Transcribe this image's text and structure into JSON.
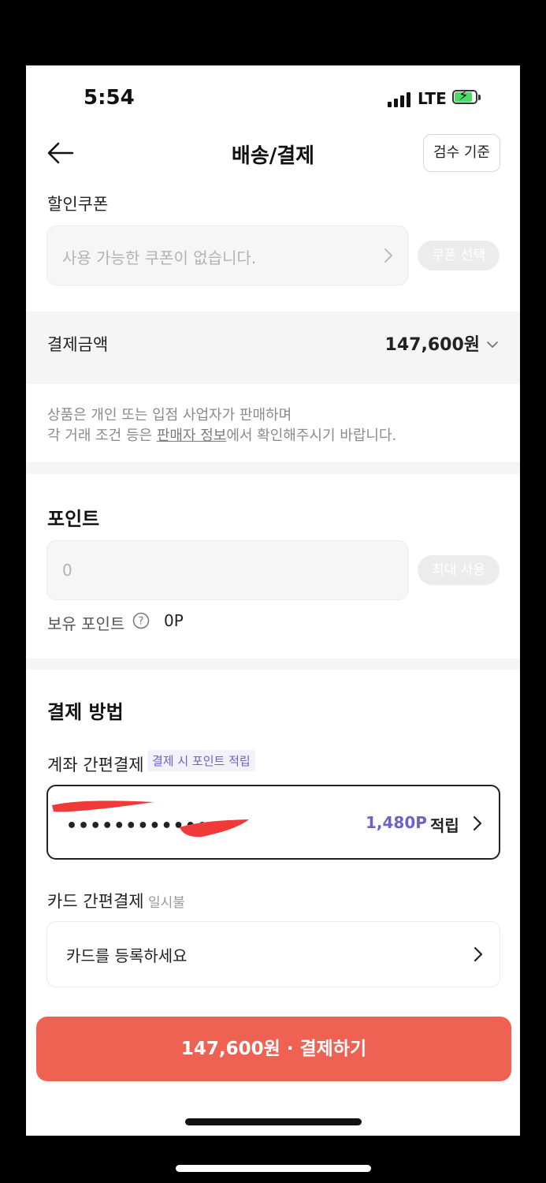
{
  "status_bar": {
    "time": "5:54",
    "network": "LTE"
  },
  "header": {
    "title": "배송/결제",
    "inspect_button": "검수 기준"
  },
  "coupon": {
    "label": "할인쿠폰",
    "placeholder": "사용 가능한 쿠폰이 없습니다.",
    "select_button": "쿠폰 선택"
  },
  "payment_amount": {
    "label": "결제금액",
    "value": "147,600원"
  },
  "notice": {
    "line1": "상품은 개인 또는 입점 사업자가 판매하며",
    "line2_prefix": "각 거래 조건 등은 ",
    "line2_link": "판매자 정보",
    "line2_suffix": "에서 확인해주시기 바랍니다."
  },
  "points": {
    "title": "포인트",
    "input_value": "0",
    "max_button": "최대 사용",
    "owned_label": "보유 포인트",
    "owned_value": "0P"
  },
  "payment_method": {
    "title": "결제 방법",
    "account": {
      "label": "계좌 간편결제",
      "badge": "결제 시 포인트 적립",
      "masked_number": "•••••••••••••",
      "reward_points": "1,480P",
      "reward_suffix": "적립"
    },
    "card": {
      "label": "카드 간편결제",
      "sublabel": "일시불",
      "register_text": "카드를 등록하세요"
    }
  },
  "pay_button": {
    "label": "147,600원 · 결제하기"
  },
  "colors": {
    "accent": "#ef6253",
    "points_purple": "#6c63c9"
  }
}
